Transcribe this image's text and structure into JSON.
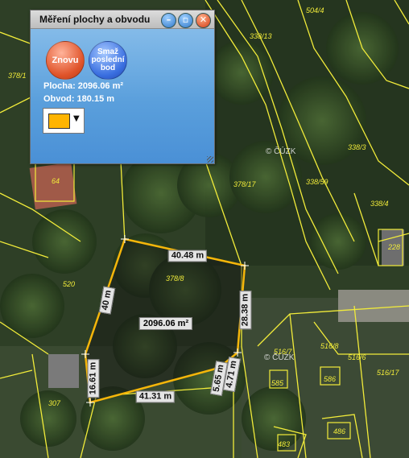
{
  "panel": {
    "title": "Měření plochy a obvodu",
    "buttons": {
      "again": "Znovu",
      "delete_last": "Smaž poslední bod"
    },
    "area_text": "Plocha: 2096.06 m²",
    "perimeter_text": "Obvod: 180.15 m",
    "fill_color": "#ffb400"
  },
  "measurement": {
    "segment_labels": [
      "40.48 m",
      "28.38 m",
      "4.71 m",
      "5.65 m",
      "41.31 m",
      "16.61 m",
      "40 m"
    ],
    "area_label": "2096.06 m²"
  },
  "map": {
    "watermark": "© ČÚZK",
    "parcel_numbers": [
      "338/13",
      "504/4",
      "378/1",
      "338/3",
      "378/17",
      "338/59",
      "338/4",
      "228",
      "378/8",
      "520",
      "516/7",
      "516/8",
      "516/6",
      "516/17",
      "585",
      "586",
      "307",
      "483",
      "486",
      "64"
    ]
  },
  "colors": {
    "measure_line": "#f5b60a",
    "parcel_line": "#f2ec3a"
  }
}
